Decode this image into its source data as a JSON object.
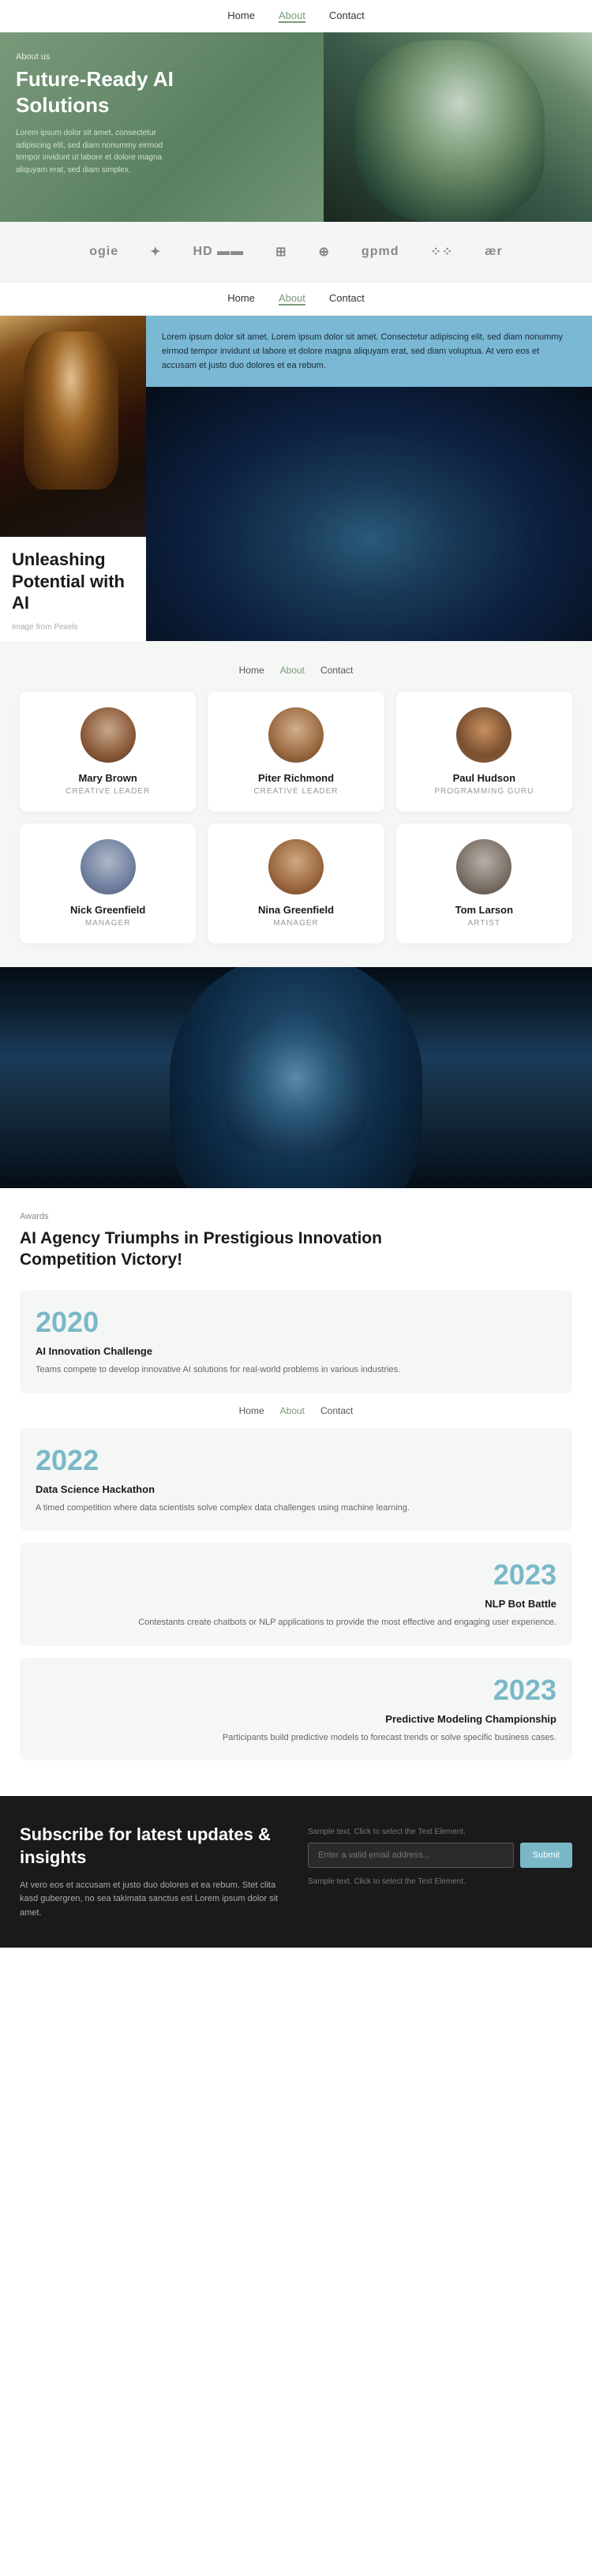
{
  "nav": {
    "items": [
      {
        "label": "Home",
        "active": false
      },
      {
        "label": "About",
        "active": true
      },
      {
        "label": "Contact",
        "active": false
      }
    ]
  },
  "hero": {
    "label": "About us",
    "title": "Future-Ready AI Solutions",
    "description": "Lorem ipsum dolor sit amet, consectetur adipiscing elit, sed diam nonummy eirmod tempor invidunt ut labore et dolore magna aliquyam erat, sed diam simplex."
  },
  "logos": {
    "items": [
      "ogie",
      "✦",
      "HD ▬▬",
      "⊞",
      "⊕",
      "gpmd",
      "⁘⁘",
      "ær"
    ]
  },
  "nav2": {
    "items": [
      {
        "label": "Home",
        "active": false
      },
      {
        "label": "About",
        "active": true
      },
      {
        "label": "Contact",
        "active": false
      }
    ]
  },
  "unleashing": {
    "title": "Unleashing Potential with AI",
    "caption": "Image from Pexels",
    "info_text": "Lorem ipsum dolor sit amet. Lorem ipsum dolor sit amet. Consectetur adipiscing elit, sed diam nonummy eirmod tempor invidunt ut labore et dolore magna aliquyam erat, sed diam voluptua. At vero eos et accusam et justo duo dolores et ea rebum."
  },
  "team": {
    "nav": [
      {
        "label": "Home",
        "active": false
      },
      {
        "label": "About",
        "active": true
      },
      {
        "label": "Contact",
        "active": false
      }
    ],
    "members": [
      {
        "name": "Mary Brown",
        "role": "CREATIVE LEADER",
        "avatar": "mary"
      },
      {
        "name": "Piter Richmond",
        "role": "CREATIVE LEADER",
        "avatar": "piter"
      },
      {
        "name": "Paul Hudson",
        "role": "PROGRAMMING GURU",
        "avatar": "paul"
      },
      {
        "name": "Nick Greenfield",
        "role": "MANAGER",
        "avatar": "nick"
      },
      {
        "name": "Nina Greenfield",
        "role": "MANAGER",
        "avatar": "nina"
      },
      {
        "name": "Tom Larson",
        "role": "ARTIST",
        "avatar": "tom"
      }
    ]
  },
  "awards": {
    "label": "Awards",
    "title": "AI Agency Triumphs in Prestigious Innovation Competition Victory!",
    "items": [
      {
        "year": "2020",
        "name": "AI Innovation Challenge",
        "description": "Teams compete to develop innovative AI solutions for real-world problems in various industries.",
        "align": "left"
      },
      {
        "year": "2022",
        "name": "Data Science Hackathon",
        "description": "A timed competition where data scientists solve complex data challenges using machine learning.",
        "align": "left"
      },
      {
        "year": "2023",
        "name": "NLP Bot Battle",
        "description": "Contestants create chatbots or NLP applications to provide the most effective and engaging user experience.",
        "align": "right"
      },
      {
        "year": "2023",
        "name": "Predictive Modeling Championship",
        "description": "Participants build predictive models to forecast trends or solve specific business cases.",
        "align": "right"
      }
    ],
    "nav": [
      {
        "label": "Home",
        "active": false
      },
      {
        "label": "About",
        "active": true
      },
      {
        "label": "Contact",
        "active": false
      }
    ]
  },
  "subscribe": {
    "title": "Subscribe for latest updates & insights",
    "description": "At vero eos et accusam et justo duo dolores et ea rebum. Stet clita kasd gubergren, no sea takimata sanctus est Lorem ipsum dolor sit amet.",
    "sample_text": "Sample text. Click to select the Text Element.",
    "input_placeholder": "Enter a valid email address...",
    "button_label": "Submit",
    "sample_text2": "Sample text. Click to select the Text Element."
  }
}
